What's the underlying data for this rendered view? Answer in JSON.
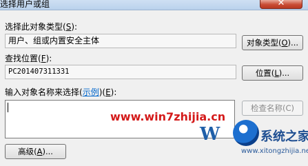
{
  "window": {
    "title": "选择用户或组",
    "close_glyph": "✕"
  },
  "object_type": {
    "label": "选择此对象类型(",
    "label_key": "S",
    "label_end": "):",
    "value": "用户、组或内置安全主体",
    "button_label": "对象类型(",
    "button_key": "O",
    "button_end": ")..."
  },
  "location": {
    "label": "查找位置(",
    "label_key": "F",
    "label_end": "):",
    "value": "PC201407311331",
    "button_label": "位置(",
    "button_key": "L",
    "button_end": ")..."
  },
  "names": {
    "label_pre": "输入对象名称来选择(",
    "label_link": "示例",
    "label_mid": ")(",
    "label_key": "E",
    "label_end": "):",
    "value": "",
    "check_button": "检查名称(C)"
  },
  "advanced": {
    "button_label": "高级(",
    "button_key": "A",
    "button_end": ")..."
  },
  "watermark": {
    "url": "www.win7zhijia.cn",
    "logo_text": "W",
    "brand": "系统之家",
    "brand_url": "www.xitongzhijia.net"
  },
  "colors": {
    "link": "#0066cc",
    "watermark_red": "#d41a1a",
    "close_red": "#c94c35"
  }
}
